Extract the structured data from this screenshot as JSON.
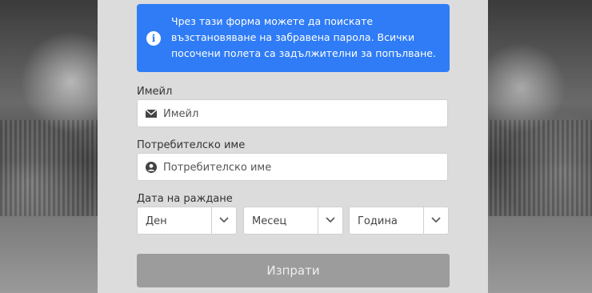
{
  "alert": {
    "text": "Чрез тази форма можете да поискате възстановяване на забравена парола. Всички посочени полета са задължителни за попълване.",
    "icon": "info-icon"
  },
  "email": {
    "label": "Имейл",
    "placeholder": "Имейл",
    "icon": "envelope-icon"
  },
  "username": {
    "label": "Потребителско име",
    "placeholder": "Потребителско име",
    "icon": "user-icon"
  },
  "birthdate": {
    "label": "Дата на раждане",
    "day": "Ден",
    "month": "Месец",
    "year": "Година"
  },
  "submit_label": "Изпрати",
  "colors": {
    "accent": "#2f7cf6",
    "panel": "#dcdcdc",
    "button_disabled": "#9c9c9c"
  }
}
